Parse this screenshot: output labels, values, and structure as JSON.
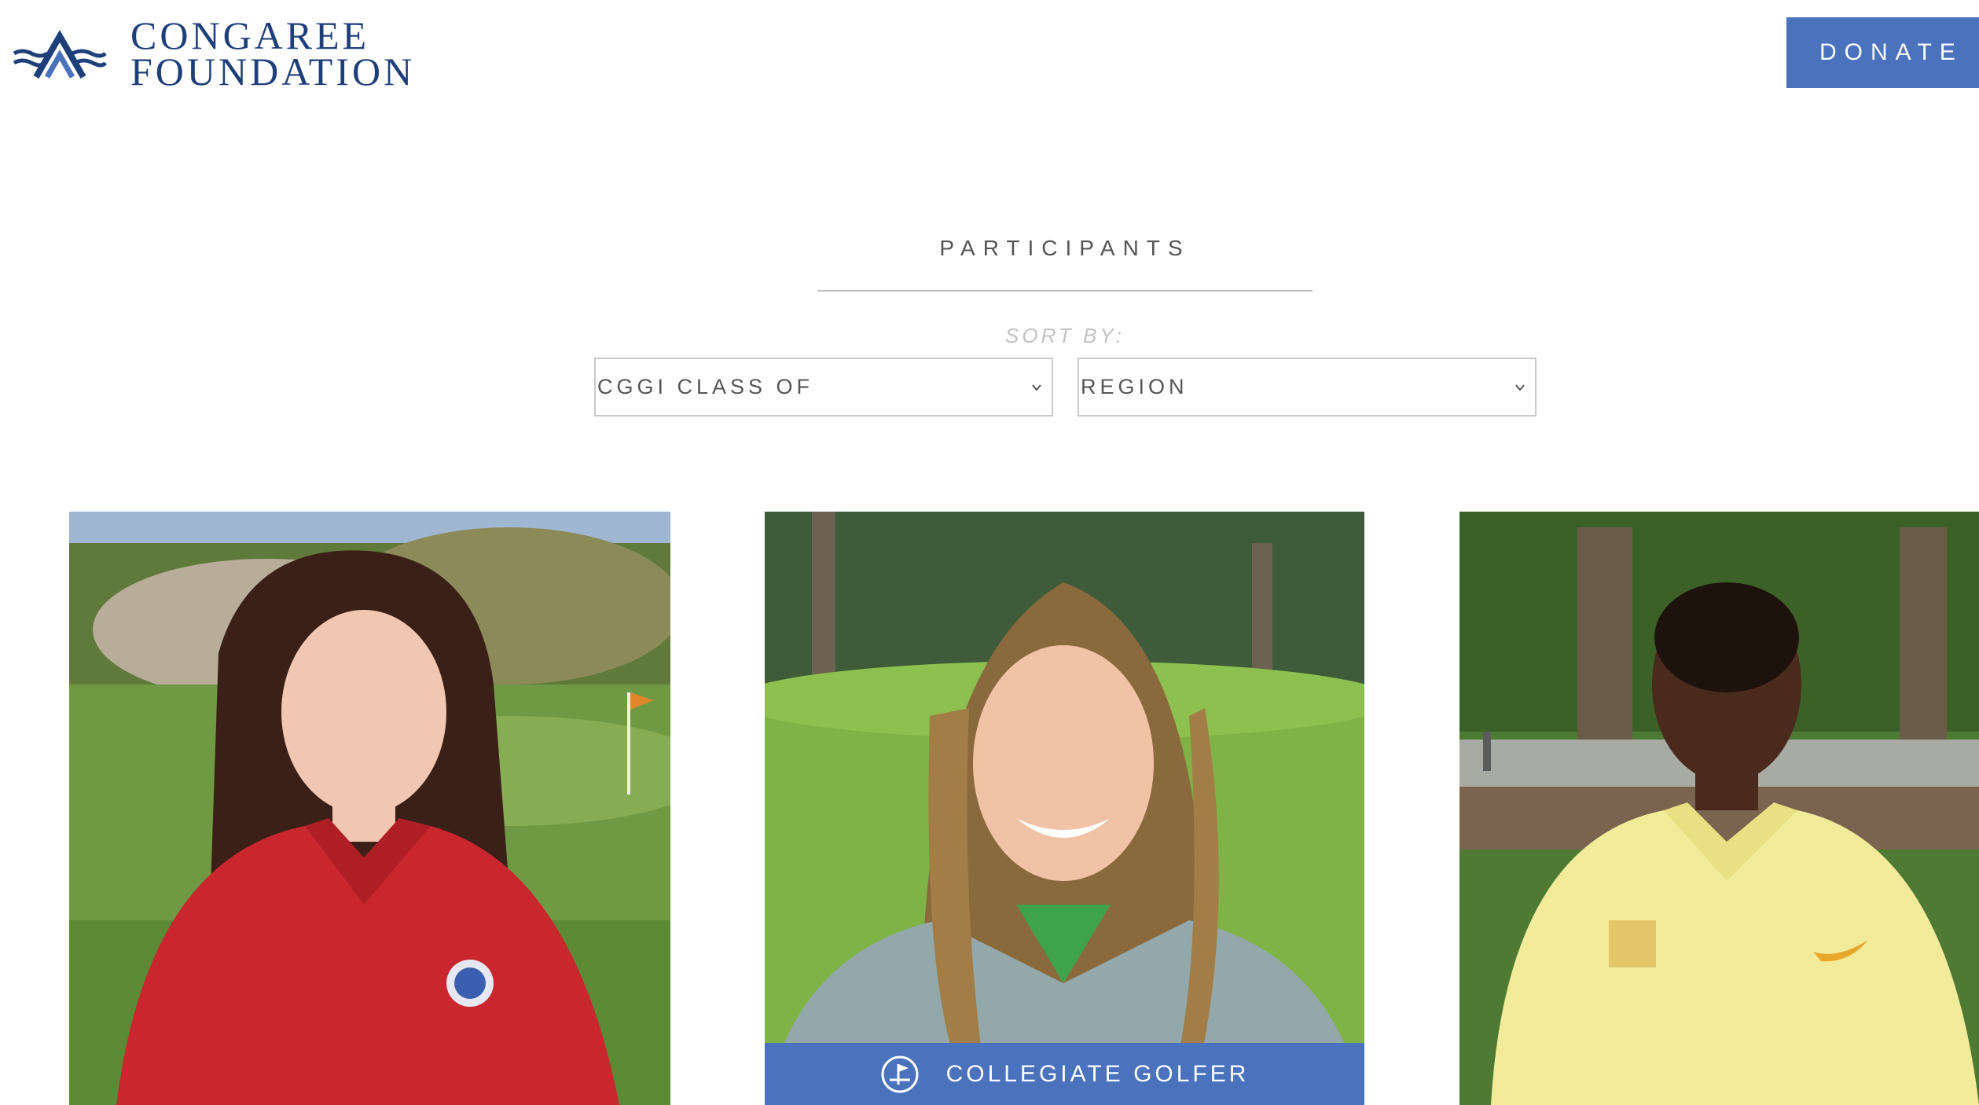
{
  "header": {
    "logo_line1": "CONGAREE",
    "logo_line2": "FOUNDATION",
    "donate_label": "DONATE"
  },
  "participants": {
    "title": "PARTICIPANTS",
    "sort_label": "SORT BY:",
    "filters": [
      {
        "selected": "CGGI CLASS OF"
      },
      {
        "selected": "REGION"
      }
    ],
    "cards": [
      {
        "photo": "golfer-red-polo-photo"
      },
      {
        "photo": "golfer-grey-top-photo",
        "badge": "COLLEGIATE GOLFER"
      },
      {
        "photo": "golfer-yellow-polo-photo"
      }
    ]
  },
  "colors": {
    "brand_navy": "#1f3f7a",
    "accent_blue": "#4a72bd",
    "text_grey": "#555555"
  },
  "icons": {
    "logo": "congaree-logo-icon",
    "dropdown": "chevron-down-icon",
    "badge": "golf-flag-icon"
  }
}
